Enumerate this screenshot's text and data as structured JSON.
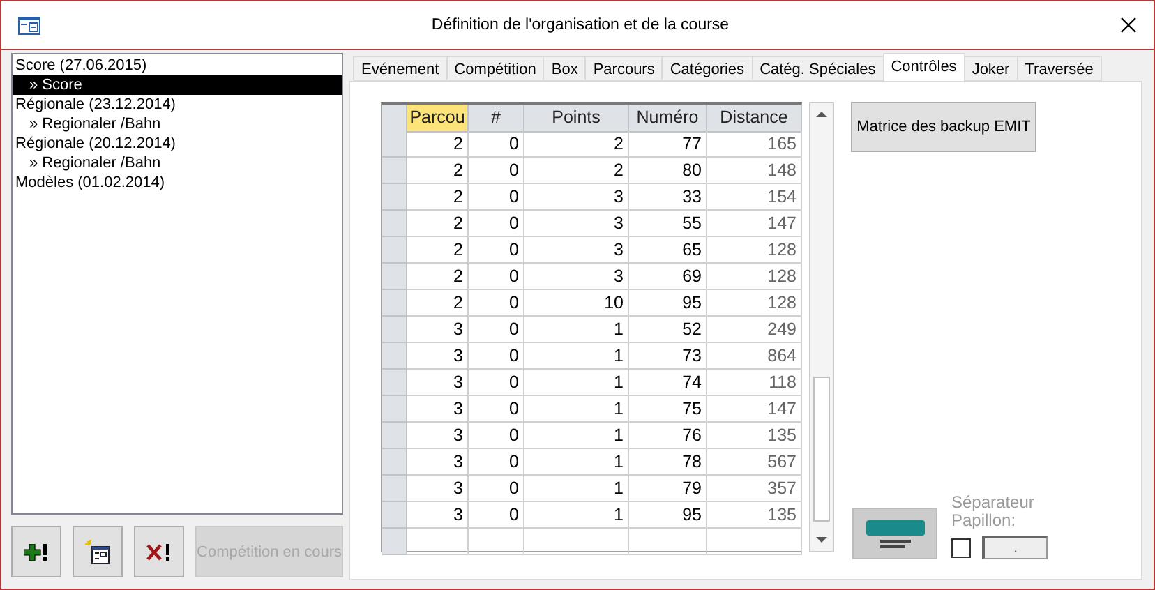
{
  "window": {
    "title": "Définition de l'organisation et de la course"
  },
  "tree": [
    {
      "label": "Score (27.06.2015)",
      "selected": false,
      "children": [
        {
          "label": "» Score",
          "selected": true
        }
      ]
    },
    {
      "label": "Régionale (23.12.2014)",
      "selected": false,
      "children": [
        {
          "label": "» Regionaler /Bahn",
          "selected": false
        }
      ]
    },
    {
      "label": "Régionale (20.12.2014)",
      "selected": false,
      "children": [
        {
          "label": "» Regionaler /Bahn",
          "selected": false
        }
      ]
    },
    {
      "label": "Modèles (01.02.2014)",
      "selected": false
    }
  ],
  "left_buttons": [
    {
      "kind": "add",
      "disabled": false
    },
    {
      "kind": "new",
      "disabled": false
    },
    {
      "kind": "delete",
      "disabled": false
    },
    {
      "kind": "text",
      "label": "Compétition en cours",
      "disabled": true
    }
  ],
  "tabs": [
    {
      "label": "Evénement",
      "selected": false
    },
    {
      "label": "Compétition",
      "selected": false
    },
    {
      "label": "Box",
      "selected": false
    },
    {
      "label": "Parcours",
      "selected": false
    },
    {
      "label": "Catégories",
      "selected": false
    },
    {
      "label": "Catég. Spéciales",
      "selected": false
    },
    {
      "label": "Contrôles",
      "selected": true
    },
    {
      "label": "Joker",
      "selected": false
    },
    {
      "label": "Traversée",
      "selected": false
    }
  ],
  "table": {
    "columns": [
      {
        "label": "Parcou",
        "selected": true
      },
      {
        "label": "#",
        "selected": false
      },
      {
        "label": "Points",
        "selected": false
      },
      {
        "label": "Numéro",
        "selected": false
      },
      {
        "label": "Distance",
        "selected": false
      }
    ],
    "rows": [
      [
        "2",
        "0",
        "2",
        "77",
        "165"
      ],
      [
        "2",
        "0",
        "2",
        "80",
        "148"
      ],
      [
        "2",
        "0",
        "3",
        "33",
        "154"
      ],
      [
        "2",
        "0",
        "3",
        "55",
        "147"
      ],
      [
        "2",
        "0",
        "3",
        "65",
        "128"
      ],
      [
        "2",
        "0",
        "3",
        "69",
        "128"
      ],
      [
        "2",
        "0",
        "10",
        "95",
        "128"
      ],
      [
        "3",
        "0",
        "1",
        "52",
        "249"
      ],
      [
        "3",
        "0",
        "1",
        "73",
        "864"
      ],
      [
        "3",
        "0",
        "1",
        "74",
        "118"
      ],
      [
        "3",
        "0",
        "1",
        "75",
        "147"
      ],
      [
        "3",
        "0",
        "1",
        "76",
        "135"
      ],
      [
        "3",
        "0",
        "1",
        "78",
        "567"
      ],
      [
        "3",
        "0",
        "1",
        "79",
        "357"
      ],
      [
        "3",
        "0",
        "1",
        "95",
        "135"
      ]
    ]
  },
  "backup_button": "Matrice des backup EMIT",
  "separator": {
    "label": "Séparateur Papillon:",
    "checked": false,
    "value": ".",
    "disabled": true
  }
}
